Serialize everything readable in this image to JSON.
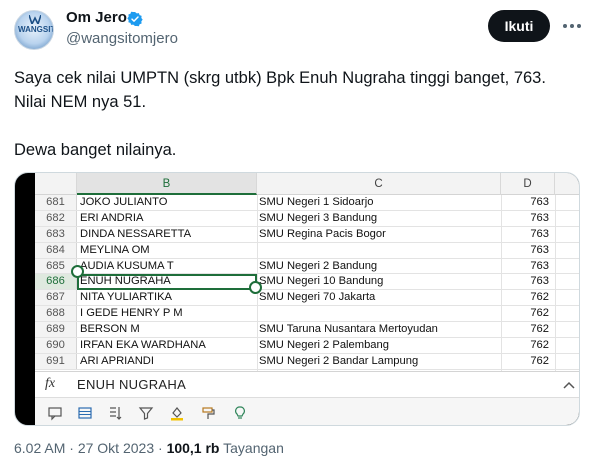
{
  "author": {
    "display_name": "Om Jero",
    "handle": "@wangsitomjero",
    "avatar_text": "WANGSIT",
    "verified": true,
    "verified_color": "#1d9bf0"
  },
  "follow_button": {
    "label": "Ikuti"
  },
  "more_button": {
    "icon": "more-horizontal-icon"
  },
  "tweet": {
    "line1": "Saya cek nilai UMPTN (skrg utbk) Bpk Enuh Nugraha tinggi banget, 763.",
    "line2": "Nilai NEM nya 51.",
    "line3": "Dewa banget nilainya."
  },
  "spreadsheet": {
    "columns": [
      "B",
      "C",
      "D"
    ],
    "selected_column": "B",
    "selected_row": "686",
    "rows": [
      {
        "n": "681",
        "name": "JOKO JULIANTO",
        "school": "SMU Negeri  1 Sidoarjo",
        "score": "763"
      },
      {
        "n": "682",
        "name": "ERI ANDRIA",
        "school": "SMU Negeri  3 Bandung",
        "score": "763"
      },
      {
        "n": "683",
        "name": "DINDA NESSARETTA",
        "school": "SMU Regina Pacis Bogor",
        "score": "763"
      },
      {
        "n": "684",
        "name": "MEYLINA OM",
        "school": "",
        "score": "763"
      },
      {
        "n": "685",
        "name": "AUDIA KUSUMA T",
        "school": "SMU Negeri  2 Bandung",
        "score": "763"
      },
      {
        "n": "686",
        "name": "ENUH NUGRAHA",
        "school": "SMU Negeri 10 Bandung",
        "score": "763"
      },
      {
        "n": "687",
        "name": "NITA YULIARTIKA",
        "school": "SMU Negeri  70 Jakarta",
        "score": "762"
      },
      {
        "n": "688",
        "name": "I GEDE HENRY P M",
        "school": "",
        "score": "762"
      },
      {
        "n": "689",
        "name": "BERSON M",
        "school": "SMU Taruna Nusantara Mertoyudan",
        "score": "762"
      },
      {
        "n": "690",
        "name": "IRFAN EKA WARDHANA",
        "school": "SMU Negeri  2 Palembang",
        "score": "762"
      },
      {
        "n": "691",
        "name": "ARI APRIANDI",
        "school": "SMU Negeri  2 Bandar Lampung",
        "score": "762"
      }
    ],
    "formula_label": "fx",
    "formula_value": "ENUH NUGRAHA",
    "accent_color": "#1e6e3a",
    "toolbar_icons": [
      "comment-icon",
      "table-icon",
      "sort-icon",
      "filter-icon",
      "fill-color-icon",
      "format-painter-icon",
      "idea-icon"
    ]
  },
  "meta": {
    "time": "6.02 AM",
    "separator1": " · ",
    "date": "27 Okt 2023",
    "separator2": " · ",
    "views": "100,1 rb",
    "views_label": "Tayangan"
  }
}
